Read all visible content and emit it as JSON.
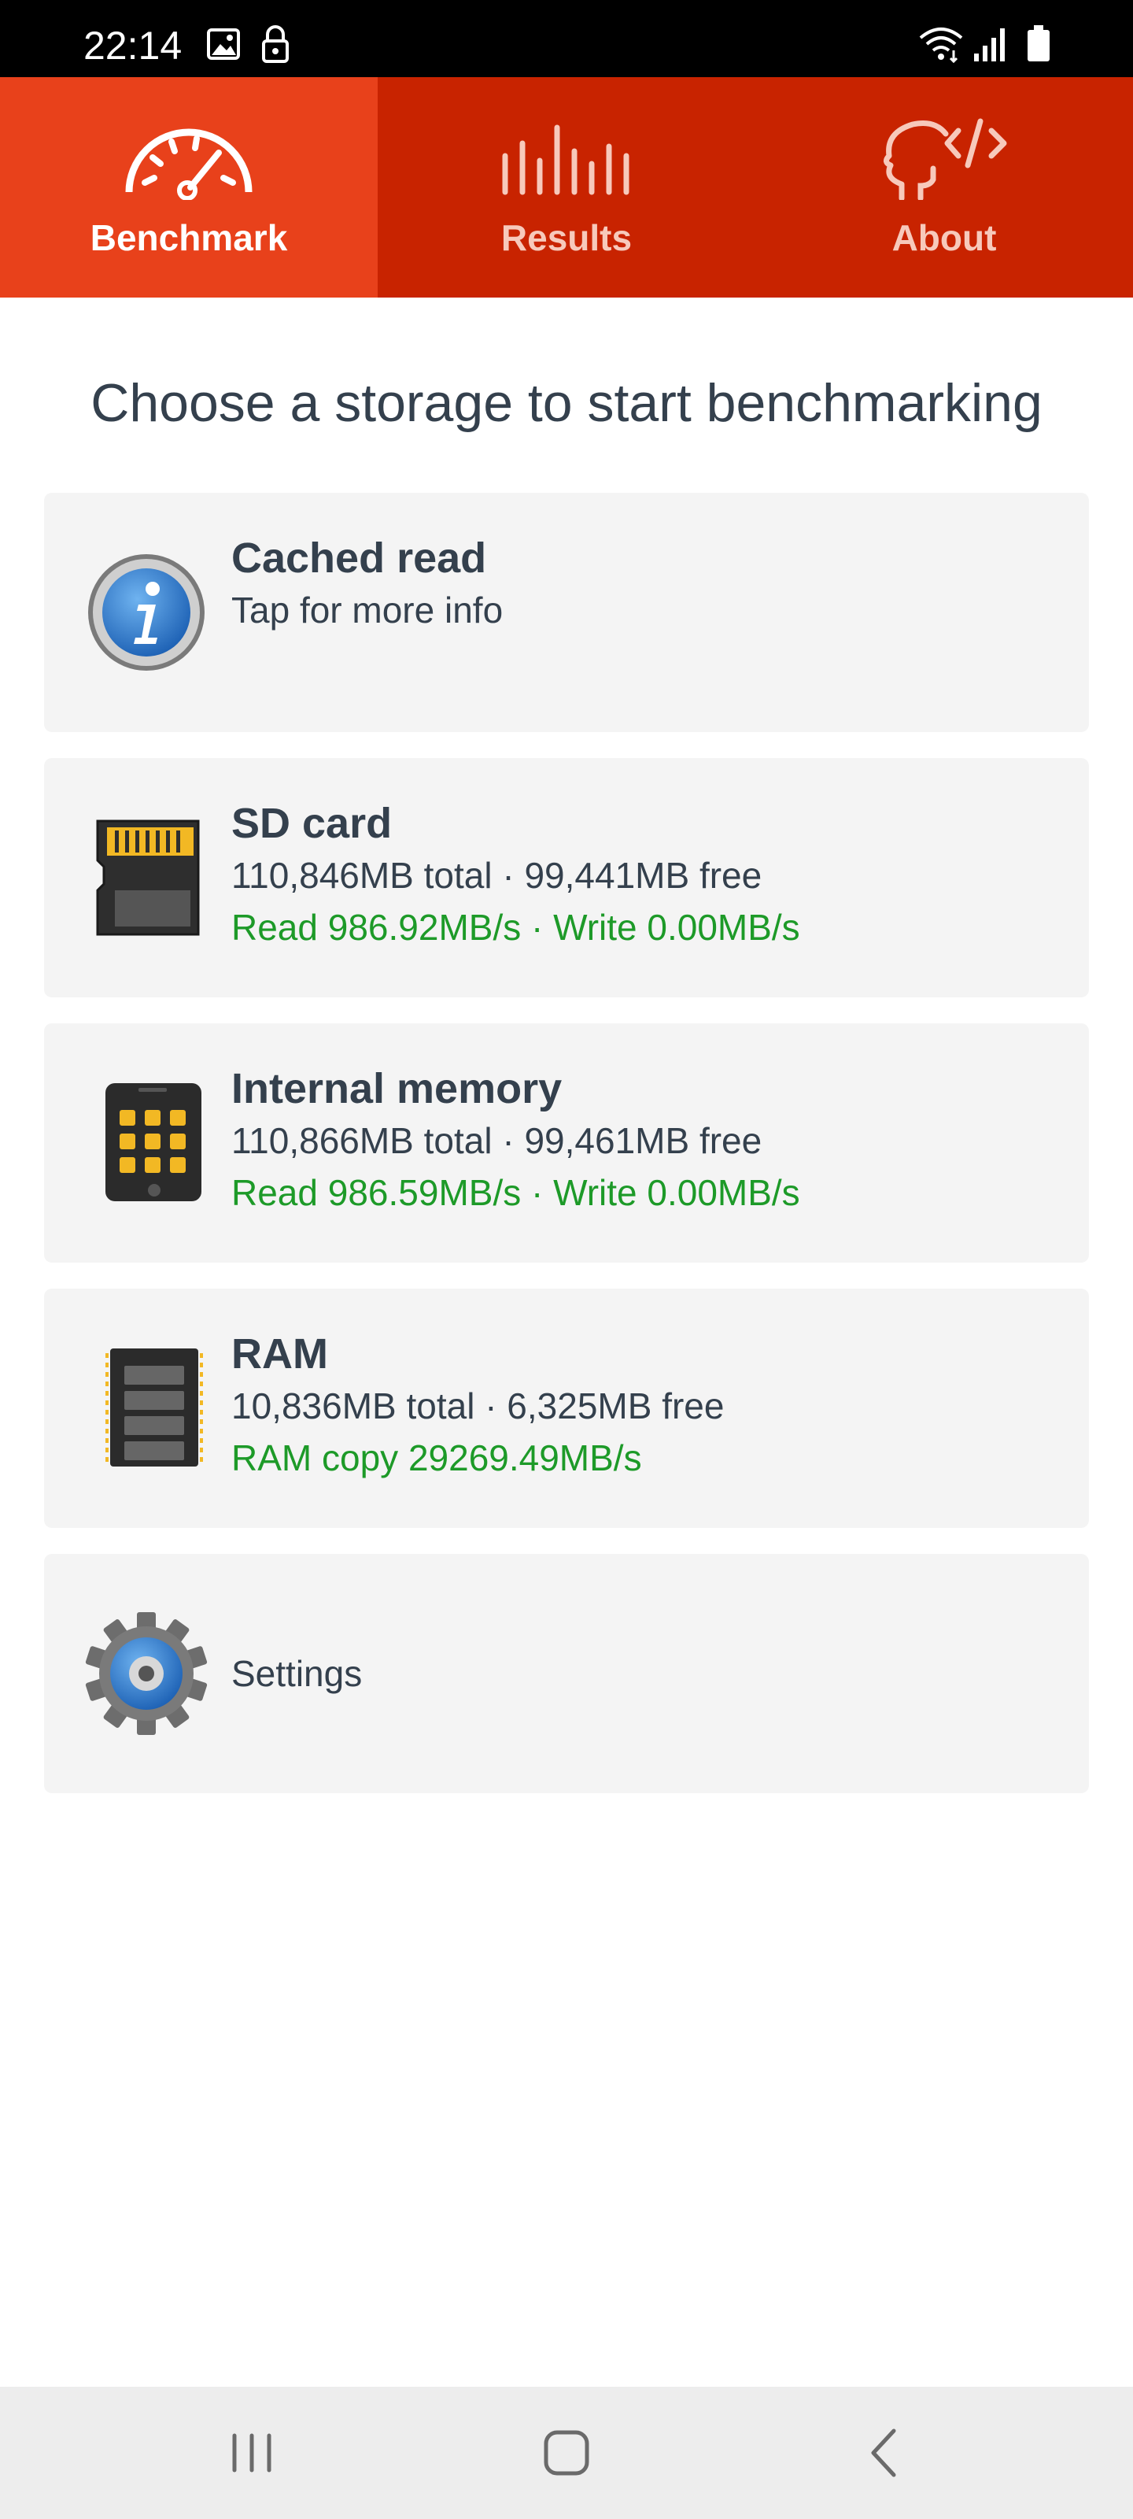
{
  "status_bar": {
    "time": "22:14",
    "icons": [
      "image-icon",
      "lock-icon",
      "wifi-icon",
      "signal-icon",
      "battery-icon"
    ]
  },
  "tabs": [
    {
      "label": "Benchmark",
      "icon": "speedometer-icon",
      "active": true
    },
    {
      "label": "Results",
      "icon": "bars-icon",
      "active": false
    },
    {
      "label": "About",
      "icon": "head-code-icon",
      "active": false
    }
  ],
  "heading": "Choose a storage to start benchmarking",
  "cards": {
    "cached_read": {
      "title": "Cached read",
      "subtitle": "Tap for more info",
      "icon": "info-icon"
    },
    "sd_card": {
      "title": "SD card",
      "capacity": "110,846MB total · 99,441MB free",
      "speed": "Read 986.92MB/s · Write 0.00MB/s",
      "icon": "sd-card-icon"
    },
    "internal_memory": {
      "title": "Internal memory",
      "capacity": "110,866MB total · 99,461MB free",
      "speed": "Read 986.59MB/s · Write 0.00MB/s",
      "icon": "phone-icon"
    },
    "ram": {
      "title": "RAM",
      "capacity": "10,836MB total · 6,325MB free",
      "speed": "RAM copy 29269.49MB/s",
      "icon": "ram-chip-icon"
    },
    "settings": {
      "label": "Settings",
      "icon": "gear-icon"
    }
  },
  "colors": {
    "tab_bar": "#c82300",
    "tab_active": "#e8411b",
    "speed_text": "#1d9a28",
    "card_bg": "#f4f4f4",
    "text": "#34404d"
  },
  "nav_bar": {
    "buttons": [
      "recent-apps-icon",
      "home-icon",
      "back-icon"
    ]
  }
}
